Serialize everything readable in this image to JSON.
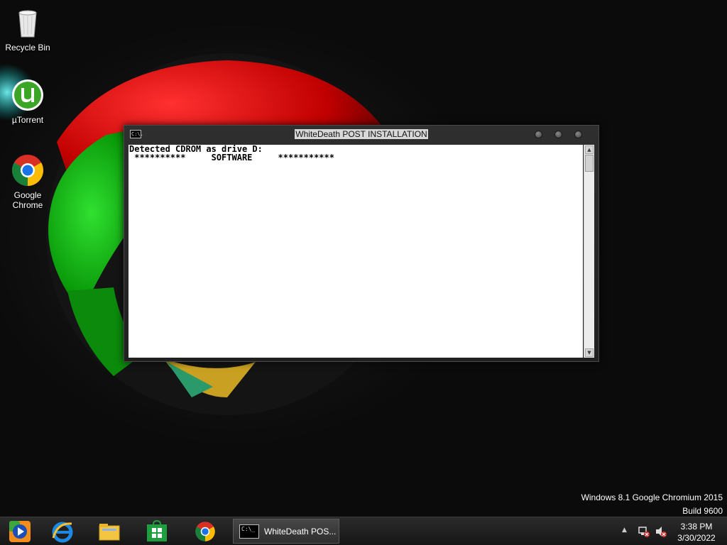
{
  "desktop": {
    "icons": [
      {
        "label": "Recycle Bin",
        "icon": "recycle-bin-icon"
      },
      {
        "label": "µTorrent",
        "icon": "utorrent-icon"
      },
      {
        "label": "Google Chrome",
        "icon": "chrome-icon"
      }
    ],
    "watermark": {
      "line1": "Windows 8.1 Google Chromium 2015",
      "line2": "Build 9600"
    }
  },
  "console": {
    "title": "WhiteDeath POST INSTALLATION",
    "icon_text": "C:\\.",
    "lines": [
      "Detected CDROM as drive D:",
      " **********     SOFTWARE     ***********"
    ]
  },
  "taskbar": {
    "pinned": [
      "media-player-icon",
      "internet-explorer-icon",
      "file-explorer-icon",
      "store-icon",
      "chrome-icon"
    ],
    "console_label": "WhiteDeath POS...",
    "console_icon_text": "C:\\_",
    "clock_time": "3:38 PM",
    "clock_date": "3/30/2022"
  },
  "colors": {
    "console_bg": "#ffffff",
    "title_highlight": "#d8d8d8",
    "taskbar": "#1e1e1e"
  }
}
